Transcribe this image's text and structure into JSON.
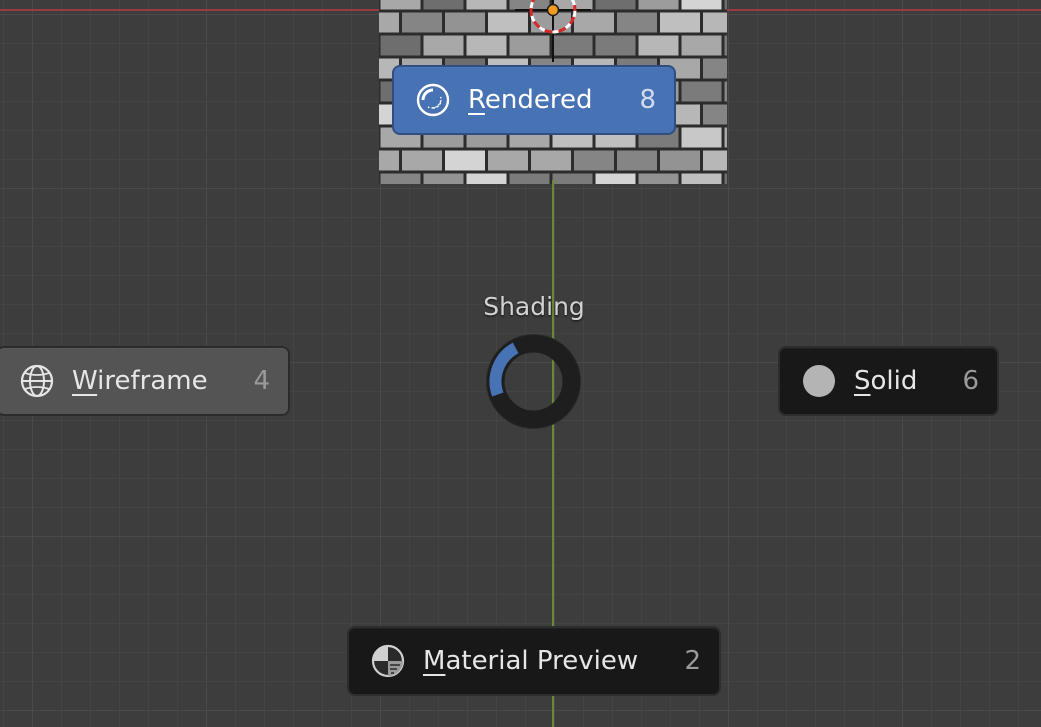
{
  "viewport": {
    "grid_color": "#4a4a4a",
    "background_color": "#3d3d3d",
    "x_axis_color": "#9b3b41",
    "y_axis_color": "#6a8b2c",
    "accent_color": "#4772b3"
  },
  "pie_menu": {
    "title": "Shading",
    "options": [
      {
        "id": "rendered",
        "icon": "rendered-shading-icon",
        "label_first": "R",
        "label_rest": "endered",
        "shortcut": "8",
        "active": true
      },
      {
        "id": "wireframe",
        "icon": "wireframe-shading-icon",
        "label_first": "W",
        "label_rest": "ireframe",
        "shortcut": "4",
        "active": false
      },
      {
        "id": "solid",
        "icon": "solid-shading-icon",
        "label_first": "S",
        "label_rest": "olid",
        "shortcut": "6",
        "active": false
      },
      {
        "id": "material",
        "icon": "material-preview-shading-icon",
        "label_first": "M",
        "label_rest": "aterial Preview",
        "shortcut": "2",
        "active": false
      }
    ]
  }
}
